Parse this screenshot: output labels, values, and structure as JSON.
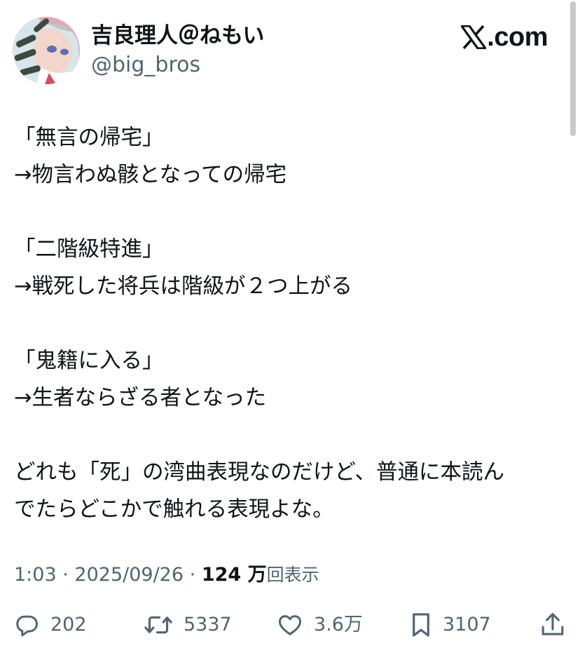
{
  "author": {
    "display_name": "吉良理人＠ねもい",
    "handle": "@big_bros"
  },
  "brand": {
    "label": ".com"
  },
  "tweet": {
    "paragraphs": [
      {
        "lines": [
          "「無言の帰宅」",
          "→物言わぬ骸となっての帰宅"
        ]
      },
      {
        "lines": [
          "「二階級特進」",
          "→戦死した将兵は階級が２つ上がる"
        ]
      },
      {
        "lines": [
          "「鬼籍に入る」",
          "→生者ならざる者となった"
        ]
      },
      {
        "lines": [
          "どれも「死」の湾曲表現なのだけど、普通に本読ん",
          "でたらどこかで触れる表現よな。"
        ]
      }
    ]
  },
  "meta": {
    "time": "1:03",
    "separator": "·",
    "date": "2025/09/26",
    "views_count": "124 万",
    "views_label": "回表示"
  },
  "actions": {
    "replies": {
      "icon": "reply-icon",
      "count": "202"
    },
    "reposts": {
      "icon": "repost-icon",
      "count": "5337"
    },
    "likes": {
      "icon": "heart-icon",
      "count": "3.6万"
    },
    "bookmarks": {
      "icon": "bookmark-icon",
      "count": "3107"
    },
    "share": {
      "icon": "share-icon"
    }
  },
  "colors": {
    "text_primary": "#0f1419",
    "text_secondary": "#536471",
    "background": "#ffffff"
  }
}
